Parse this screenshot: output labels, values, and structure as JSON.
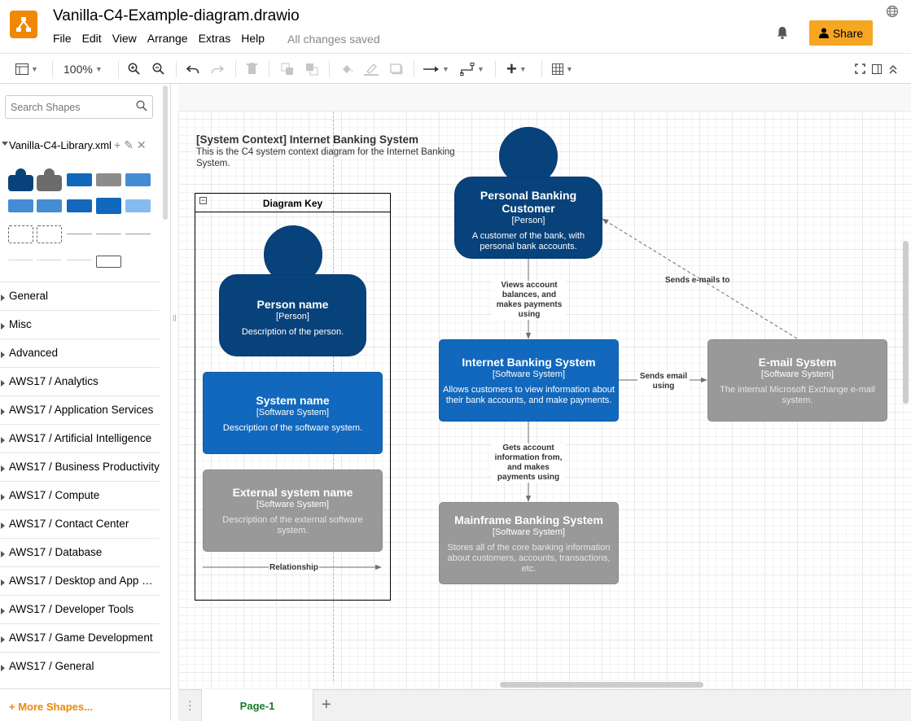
{
  "app": {
    "title": "Vanilla-C4-Example-diagram.drawio",
    "menu": [
      "File",
      "Edit",
      "View",
      "Arrange",
      "Extras",
      "Help"
    ],
    "save_status": "All changes saved",
    "share_label": "Share",
    "brand_color": "#f08705"
  },
  "toolbar": {
    "zoom": "100%",
    "icons": [
      "format-panel-icon",
      "zoom-in-icon",
      "zoom-out-icon",
      "undo-icon",
      "redo-icon",
      "delete-icon",
      "to-front-icon",
      "to-back-icon",
      "fill-color-icon",
      "line-color-icon",
      "shadow-icon",
      "connection-icon",
      "waypoints-icon",
      "insert-icon",
      "table-icon",
      "fullscreen-icon",
      "split-panel-icon",
      "collapse-icon"
    ]
  },
  "sidebar": {
    "search_placeholder": "Search Shapes",
    "library_name": "Vanilla-C4-Library.xml",
    "categories": [
      "General",
      "Misc",
      "Advanced",
      "AWS17 / Analytics",
      "AWS17 / Application Services",
      "AWS17 / Artificial Intelligence",
      "AWS17 / Business Productivity",
      "AWS17 / Compute",
      "AWS17 / Contact Center",
      "AWS17 / Database",
      "AWS17 / Desktop and App St...",
      "AWS17 / Developer Tools",
      "AWS17 / Game Development",
      "AWS17 / General"
    ],
    "more_shapes": "+ More Shapes..."
  },
  "diagram": {
    "title": "[System Context] Internet Banking System",
    "subtitle": "This is the C4 system context diagram for the Internet Banking System.",
    "key": {
      "title": "Diagram Key",
      "person": {
        "name": "Person name",
        "type": "[Person]",
        "desc": "Description of the person."
      },
      "system": {
        "name": "System name",
        "type": "[Software System]",
        "desc": "Description of the software system."
      },
      "external": {
        "name": "External system name",
        "type": "[Software System]",
        "desc": "Description of the external software system."
      },
      "relationship": "Relationship"
    },
    "customer": {
      "name": "Personal Banking Customer",
      "type": "[Person]",
      "desc": "A customer of the bank, with personal bank accounts."
    },
    "ibs": {
      "name": "Internet Banking System",
      "type": "[Software System]",
      "desc": "Allows customers to view information about their bank accounts, and make payments."
    },
    "email": {
      "name": "E-mail System",
      "type": "[Software System]",
      "desc": "The internal Microsoft Exchange e-mail system."
    },
    "mainframe": {
      "name": "Mainframe Banking System",
      "type": "[Software System]",
      "desc": "Stores all of the core banking information about customers, accounts, transactions, etc."
    },
    "edges": {
      "views": "Views account balances, and makes payments using",
      "sends_email": "Sends email using",
      "emails_to": "Sends e-mails to",
      "gets_info": "Gets account information from, and makes payments using"
    },
    "colors": {
      "person": "#08427b",
      "system": "#1168bd",
      "external": "#999999"
    }
  },
  "pages": {
    "current": "Page-1"
  }
}
